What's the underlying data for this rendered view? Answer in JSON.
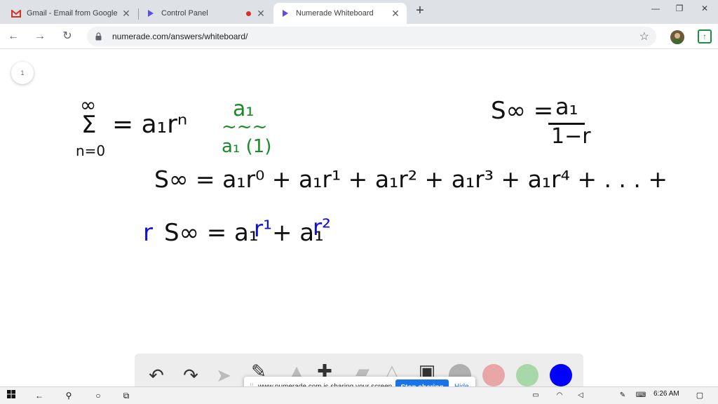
{
  "browser": {
    "tabs": [
      {
        "title": "Gmail - Email from Google",
        "icon": "gmail-icon"
      },
      {
        "title": "Control Panel",
        "icon": "numerade-icon"
      },
      {
        "title": "Numerade Whiteboard",
        "icon": "numerade-icon",
        "active": true
      }
    ],
    "new_tab": "+",
    "url": "numerade.com/answers/whiteboard/"
  },
  "board": {
    "page_number": "1",
    "sum_top": "∞",
    "sum_symbol": "Σ",
    "sum_bottom": "n=0",
    "sum_rhs": "= a₁rⁿ",
    "note_top": "a₁",
    "note_wave": "~~~",
    "note_bottom": "a₁ (1)",
    "formula_lhs": "S∞ =",
    "formula_num": "a₁",
    "formula_den": "1−r",
    "line2": "S∞ = a₁r⁰ + a₁r¹ + a₁r² + a₁r³ + a₁r⁴ + . . . +",
    "line3_r": "r",
    "line3_a": "S∞ = a₁",
    "line3_r1": "r¹",
    "line3_b": "+ a₁",
    "line3_r2": "r²"
  },
  "colors": {
    "green": "#1a8a2a",
    "blue": "#1010e0",
    "swatch_gray": "#b0b0b0",
    "swatch_red": "#e8a6a6",
    "swatch_green": "#a8d8a8",
    "swatch_blue": "#0000ff"
  },
  "share_banner": {
    "message": "www.numerade.com is sharing your screen.",
    "stop": "Stop sharing",
    "hide": "Hide"
  },
  "taskbar": {
    "time": "6:26 AM"
  }
}
